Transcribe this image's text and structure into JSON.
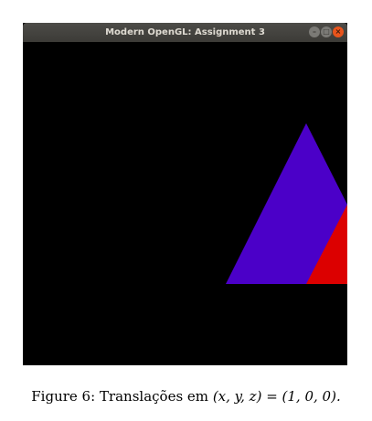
{
  "window": {
    "title": "Modern OpenGL: Assignment 3",
    "buttons": {
      "minimize_icon": "minimize-icon",
      "maximize_icon": "maximize-icon",
      "close_icon": "close-icon"
    },
    "background_color": "#000000"
  },
  "scene": {
    "triangles": [
      {
        "name": "blue-triangle",
        "color": "#4b00c8"
      },
      {
        "name": "red-triangle",
        "color": "#dc0000"
      }
    ]
  },
  "caption": {
    "label": "Figure 6:",
    "text": "Translações em",
    "math": "(x, y, z) = (1, 0, 0)."
  }
}
